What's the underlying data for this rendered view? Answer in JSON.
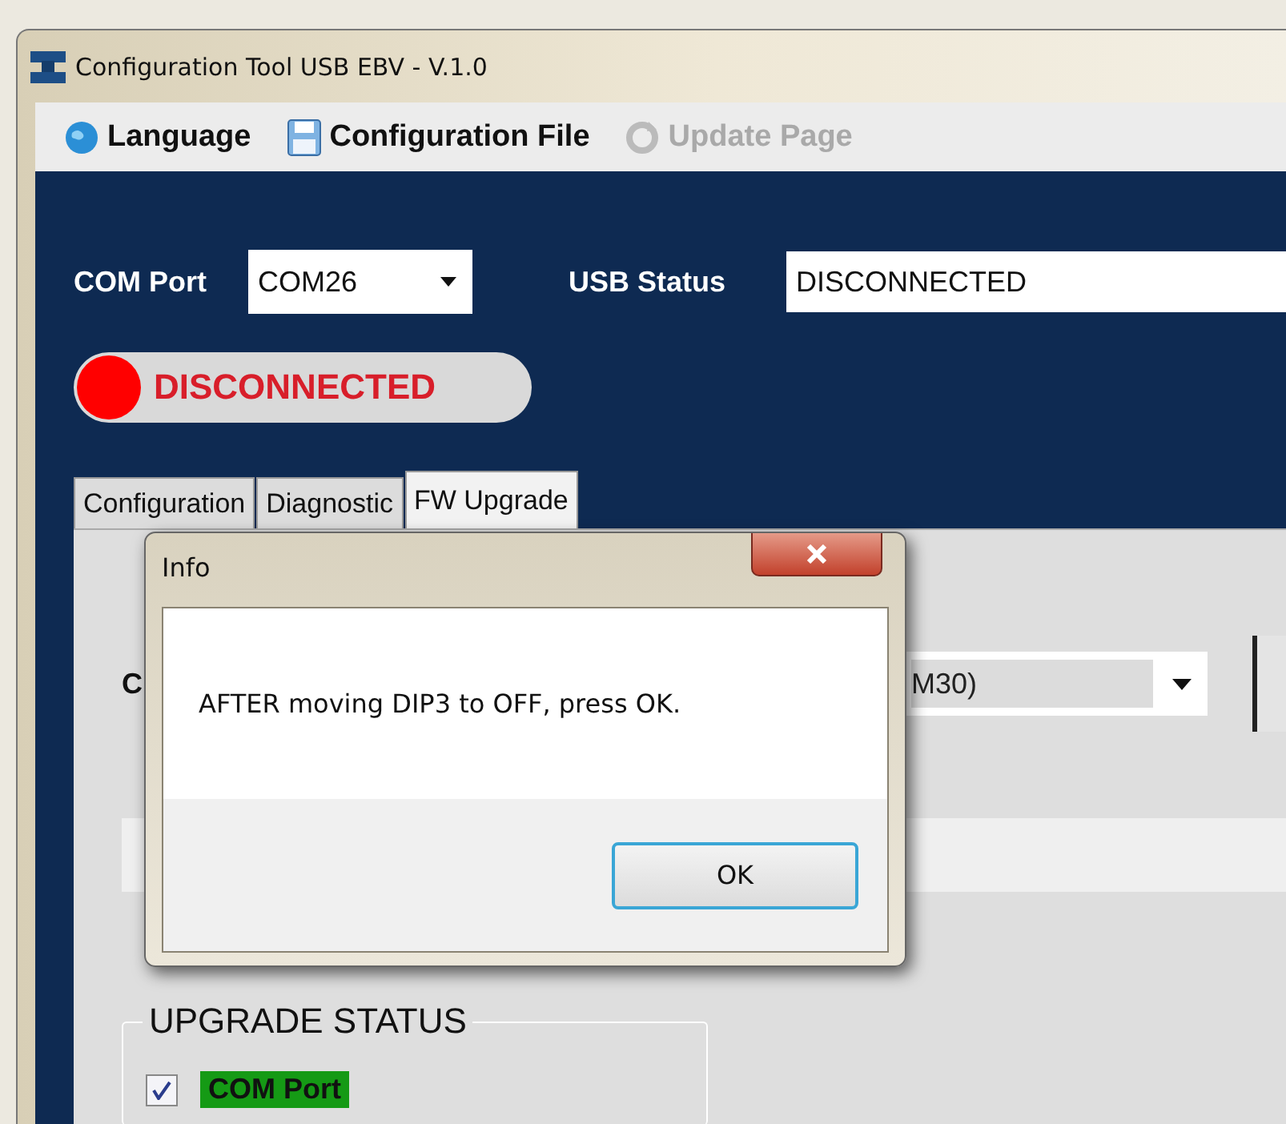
{
  "window": {
    "title": "Configuration Tool USB EBV - V.1.0"
  },
  "menu": [
    {
      "label": "Language",
      "disabled": false
    },
    {
      "label": "Configuration File",
      "disabled": false
    },
    {
      "label": "Update Page",
      "disabled": true
    }
  ],
  "connection": {
    "com_port_label": "COM Port",
    "com_port": "COM26",
    "usb_status_label": "USB Status",
    "usb_status": "DISCONNECTED"
  },
  "status_indicator": {
    "text": "DISCONNECTED",
    "connected": false
  },
  "tabs": [
    {
      "label": "Configuration",
      "selected": false
    },
    {
      "label": "Diagnostic",
      "selected": false
    },
    {
      "label": "FW Upgrade",
      "selected": true
    }
  ],
  "fw_upgrade": {
    "port_label": "C",
    "port_select": "M30)",
    "upgrade_status": {
      "title": "UPGRADE STATUS",
      "items": [
        {
          "label": "COM Port",
          "checked": true,
          "done": true
        }
      ]
    }
  },
  "dialog": {
    "title": "Info",
    "message": "AFTER moving DIP3 to OFF, press OK.",
    "buttons": [
      {
        "label": "OK",
        "default": true
      }
    ]
  }
}
